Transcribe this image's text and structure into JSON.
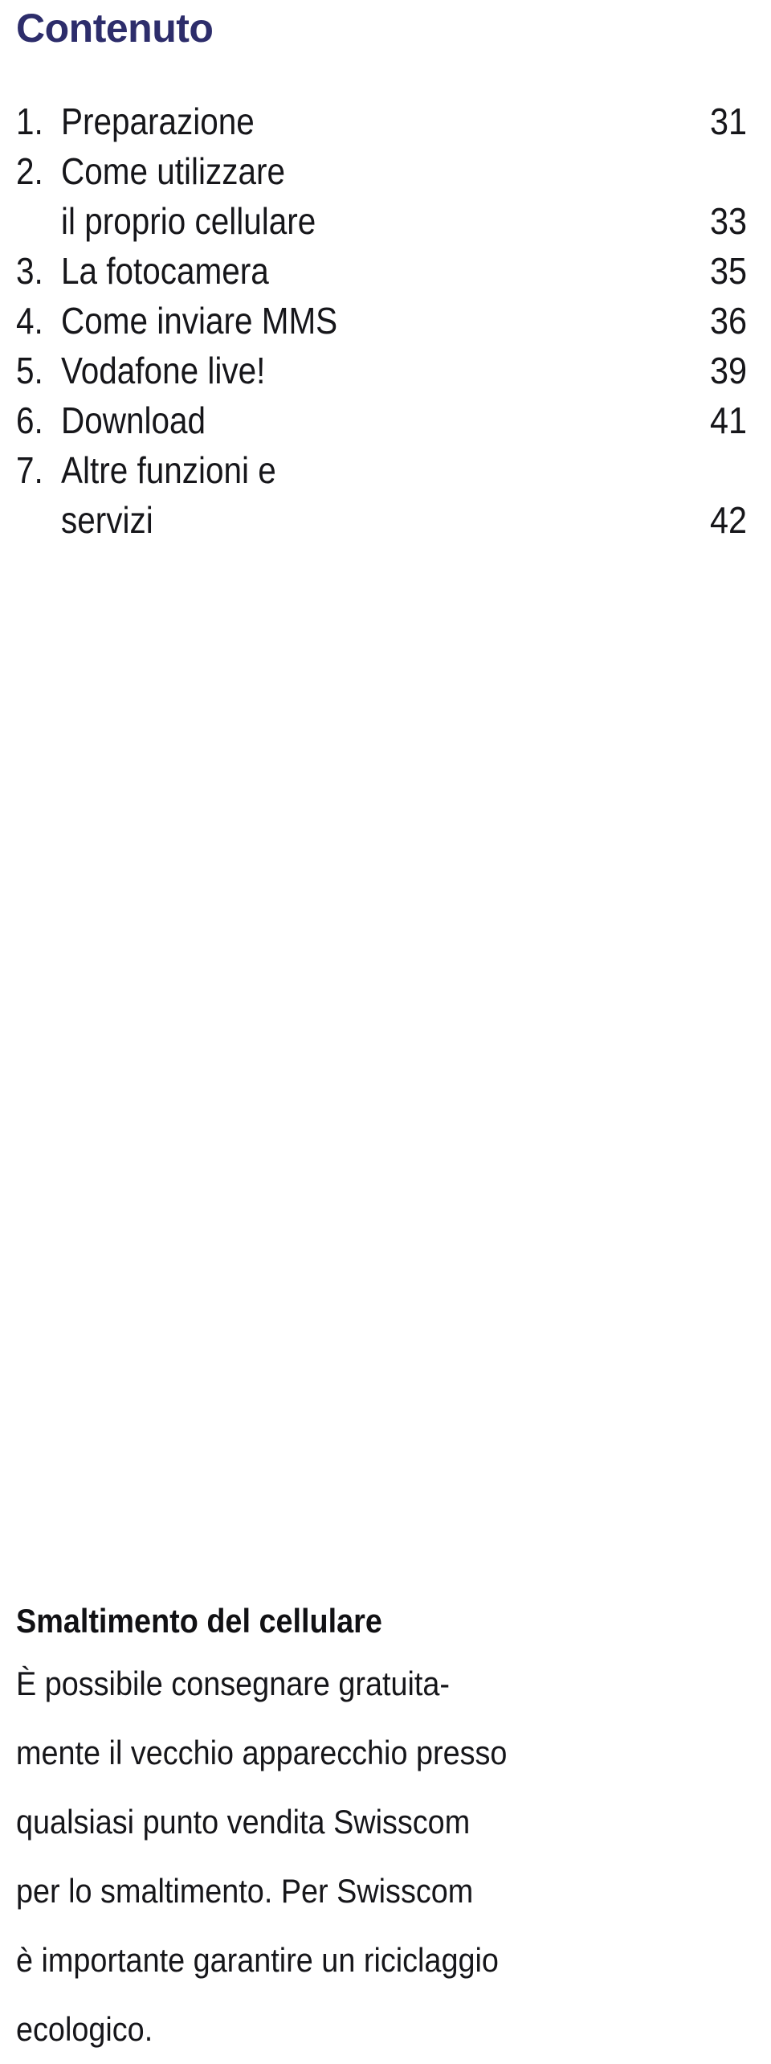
{
  "document": {
    "title": "Contenuto",
    "title_color": "#2d2d6b",
    "body_color": "#16161a",
    "background_color": "#ffffff"
  },
  "toc": {
    "entries": [
      {
        "number": "1.",
        "label": "Preparazione",
        "page": "31"
      },
      {
        "number": "2.",
        "label": "Come utilizzare",
        "page": ""
      },
      {
        "number": "",
        "label": "il proprio cellulare",
        "page": "33"
      },
      {
        "number": "3.",
        "label": "La fotocamera",
        "page": "35"
      },
      {
        "number": "4.",
        "label": "Come inviare MMS",
        "page": "36"
      },
      {
        "number": "5.",
        "label": "Vodafone live!",
        "page": "39"
      },
      {
        "number": "6.",
        "label": "Download",
        "page": "41"
      },
      {
        "number": "7.",
        "label": "Altre funzioni e",
        "page": ""
      },
      {
        "number": "",
        "label": "servizi",
        "page": "42"
      }
    ]
  },
  "disposal": {
    "heading": "Smaltimento del cellulare",
    "lines": [
      "È possibile consegnare gratuita-",
      "mente il vecchio apparecchio presso",
      "qualsiasi punto vendita Swisscom",
      "per lo smaltimento. Per Swisscom",
      "è importante garantire un riciclaggio",
      "ecologico."
    ]
  }
}
